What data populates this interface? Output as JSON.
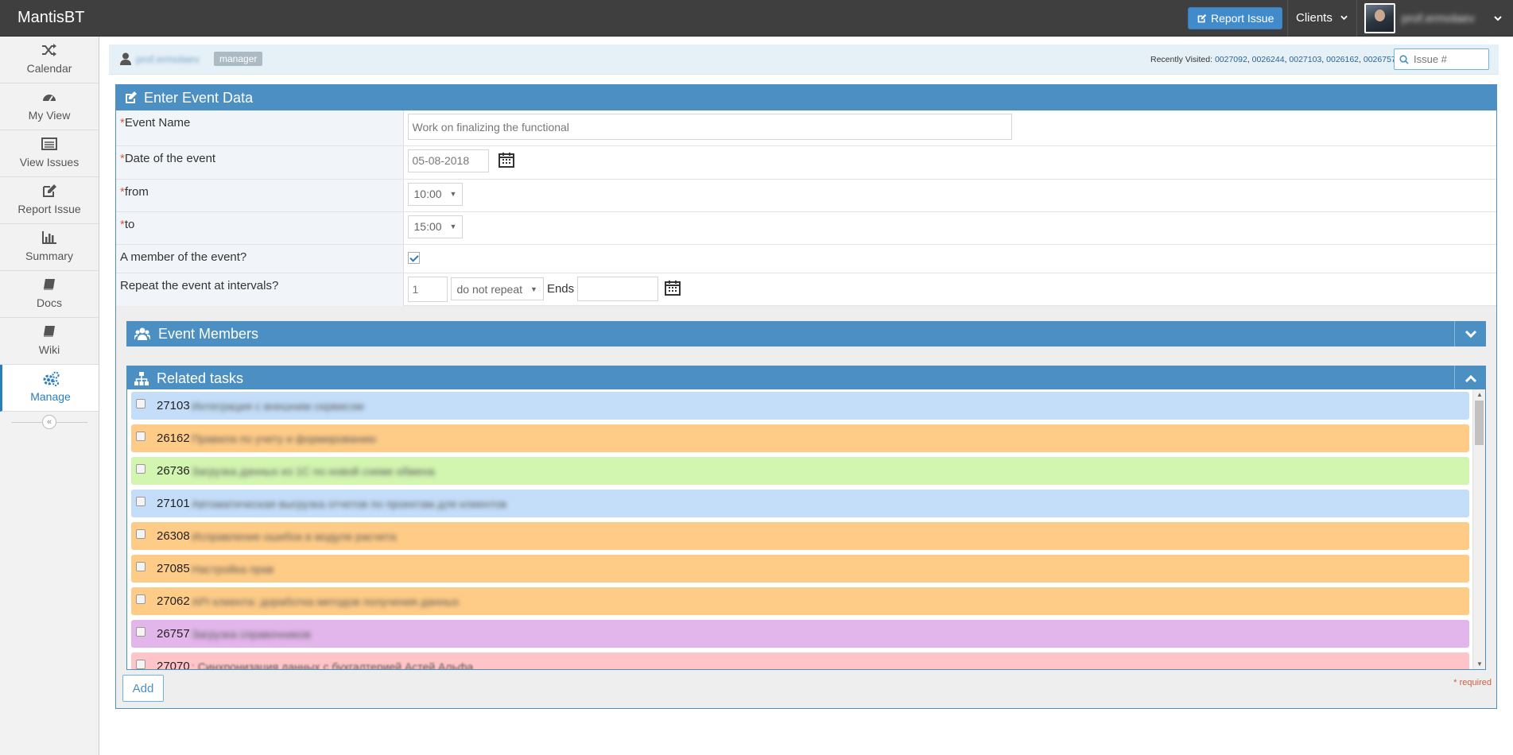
{
  "app": {
    "brand": "MantisBT",
    "report_button": "Report Issue",
    "clients_label": "Clients",
    "username": "prof.ermolaev"
  },
  "sidebar": {
    "items": [
      {
        "label": "Calendar",
        "icon": "shuffle-icon"
      },
      {
        "label": "My View",
        "icon": "dashboard-icon"
      },
      {
        "label": "View Issues",
        "icon": "list-icon"
      },
      {
        "label": "Report Issue",
        "icon": "edit-icon"
      },
      {
        "label": "Summary",
        "icon": "bar-chart-icon"
      },
      {
        "label": "Docs",
        "icon": "book-icon"
      },
      {
        "label": "Wiki",
        "icon": "book-icon"
      },
      {
        "label": "Manage",
        "icon": "cogs-icon"
      }
    ]
  },
  "breadcrumb": {
    "user": "prof.ermolaev",
    "role": "manager",
    "recent_label": "Recently Visited:",
    "recent_issues": [
      "0027092",
      "0026244",
      "0027103",
      "0026162",
      "0026757"
    ],
    "search_placeholder": "Issue #"
  },
  "form": {
    "title": "Enter Event Data",
    "required_mark": "*",
    "event_name_label": "Event Name",
    "event_name_value": "Work on finalizing the functional",
    "date_label": "Date of the event",
    "date_value": "05-08-2018",
    "from_label": "from",
    "from_value": "10:00",
    "to_label": "to",
    "to_value": "15:00",
    "member_label": "A member of the event?",
    "member_checked": true,
    "repeat_label": "Repeat the event at intervals?",
    "repeat_interval": "1",
    "repeat_mode": "do not repeat",
    "ends_label": "Ends",
    "ends_value": ""
  },
  "members_section": {
    "title": "Event Members"
  },
  "tasks_section": {
    "title": "Related tasks",
    "tasks": [
      {
        "id": "27103",
        "title": "Интеграция с внешним сервисом",
        "color": "#c4def9"
      },
      {
        "id": "26162",
        "title": "Правила по учету и формированию",
        "color": "#ffcc88"
      },
      {
        "id": "26736",
        "title": "Загрузка данных из 1С по новой схеме обмена",
        "color": "#d2f5b0"
      },
      {
        "id": "27101",
        "title": "Автоматическая выгрузка отчетов по проектам для клиентов",
        "color": "#c4def9"
      },
      {
        "id": "26308",
        "title": "Исправление ошибок в модуле расчета",
        "color": "#ffcc88"
      },
      {
        "id": "27085",
        "title": "Настройка прав",
        "color": "#ffcc88"
      },
      {
        "id": "27062",
        "title": "API клиента: доработка методов получения данных",
        "color": "#ffcc88"
      },
      {
        "id": "26757",
        "title": "Загрузка справочников",
        "color": "#e2b6ea"
      },
      {
        "id": "27070",
        "title": ": Синхронизация данных с бухгалтерией Астей Альфа",
        "color": "#ffc4c8"
      }
    ]
  },
  "actions": {
    "add_button": "Add",
    "required_note": "* required"
  }
}
